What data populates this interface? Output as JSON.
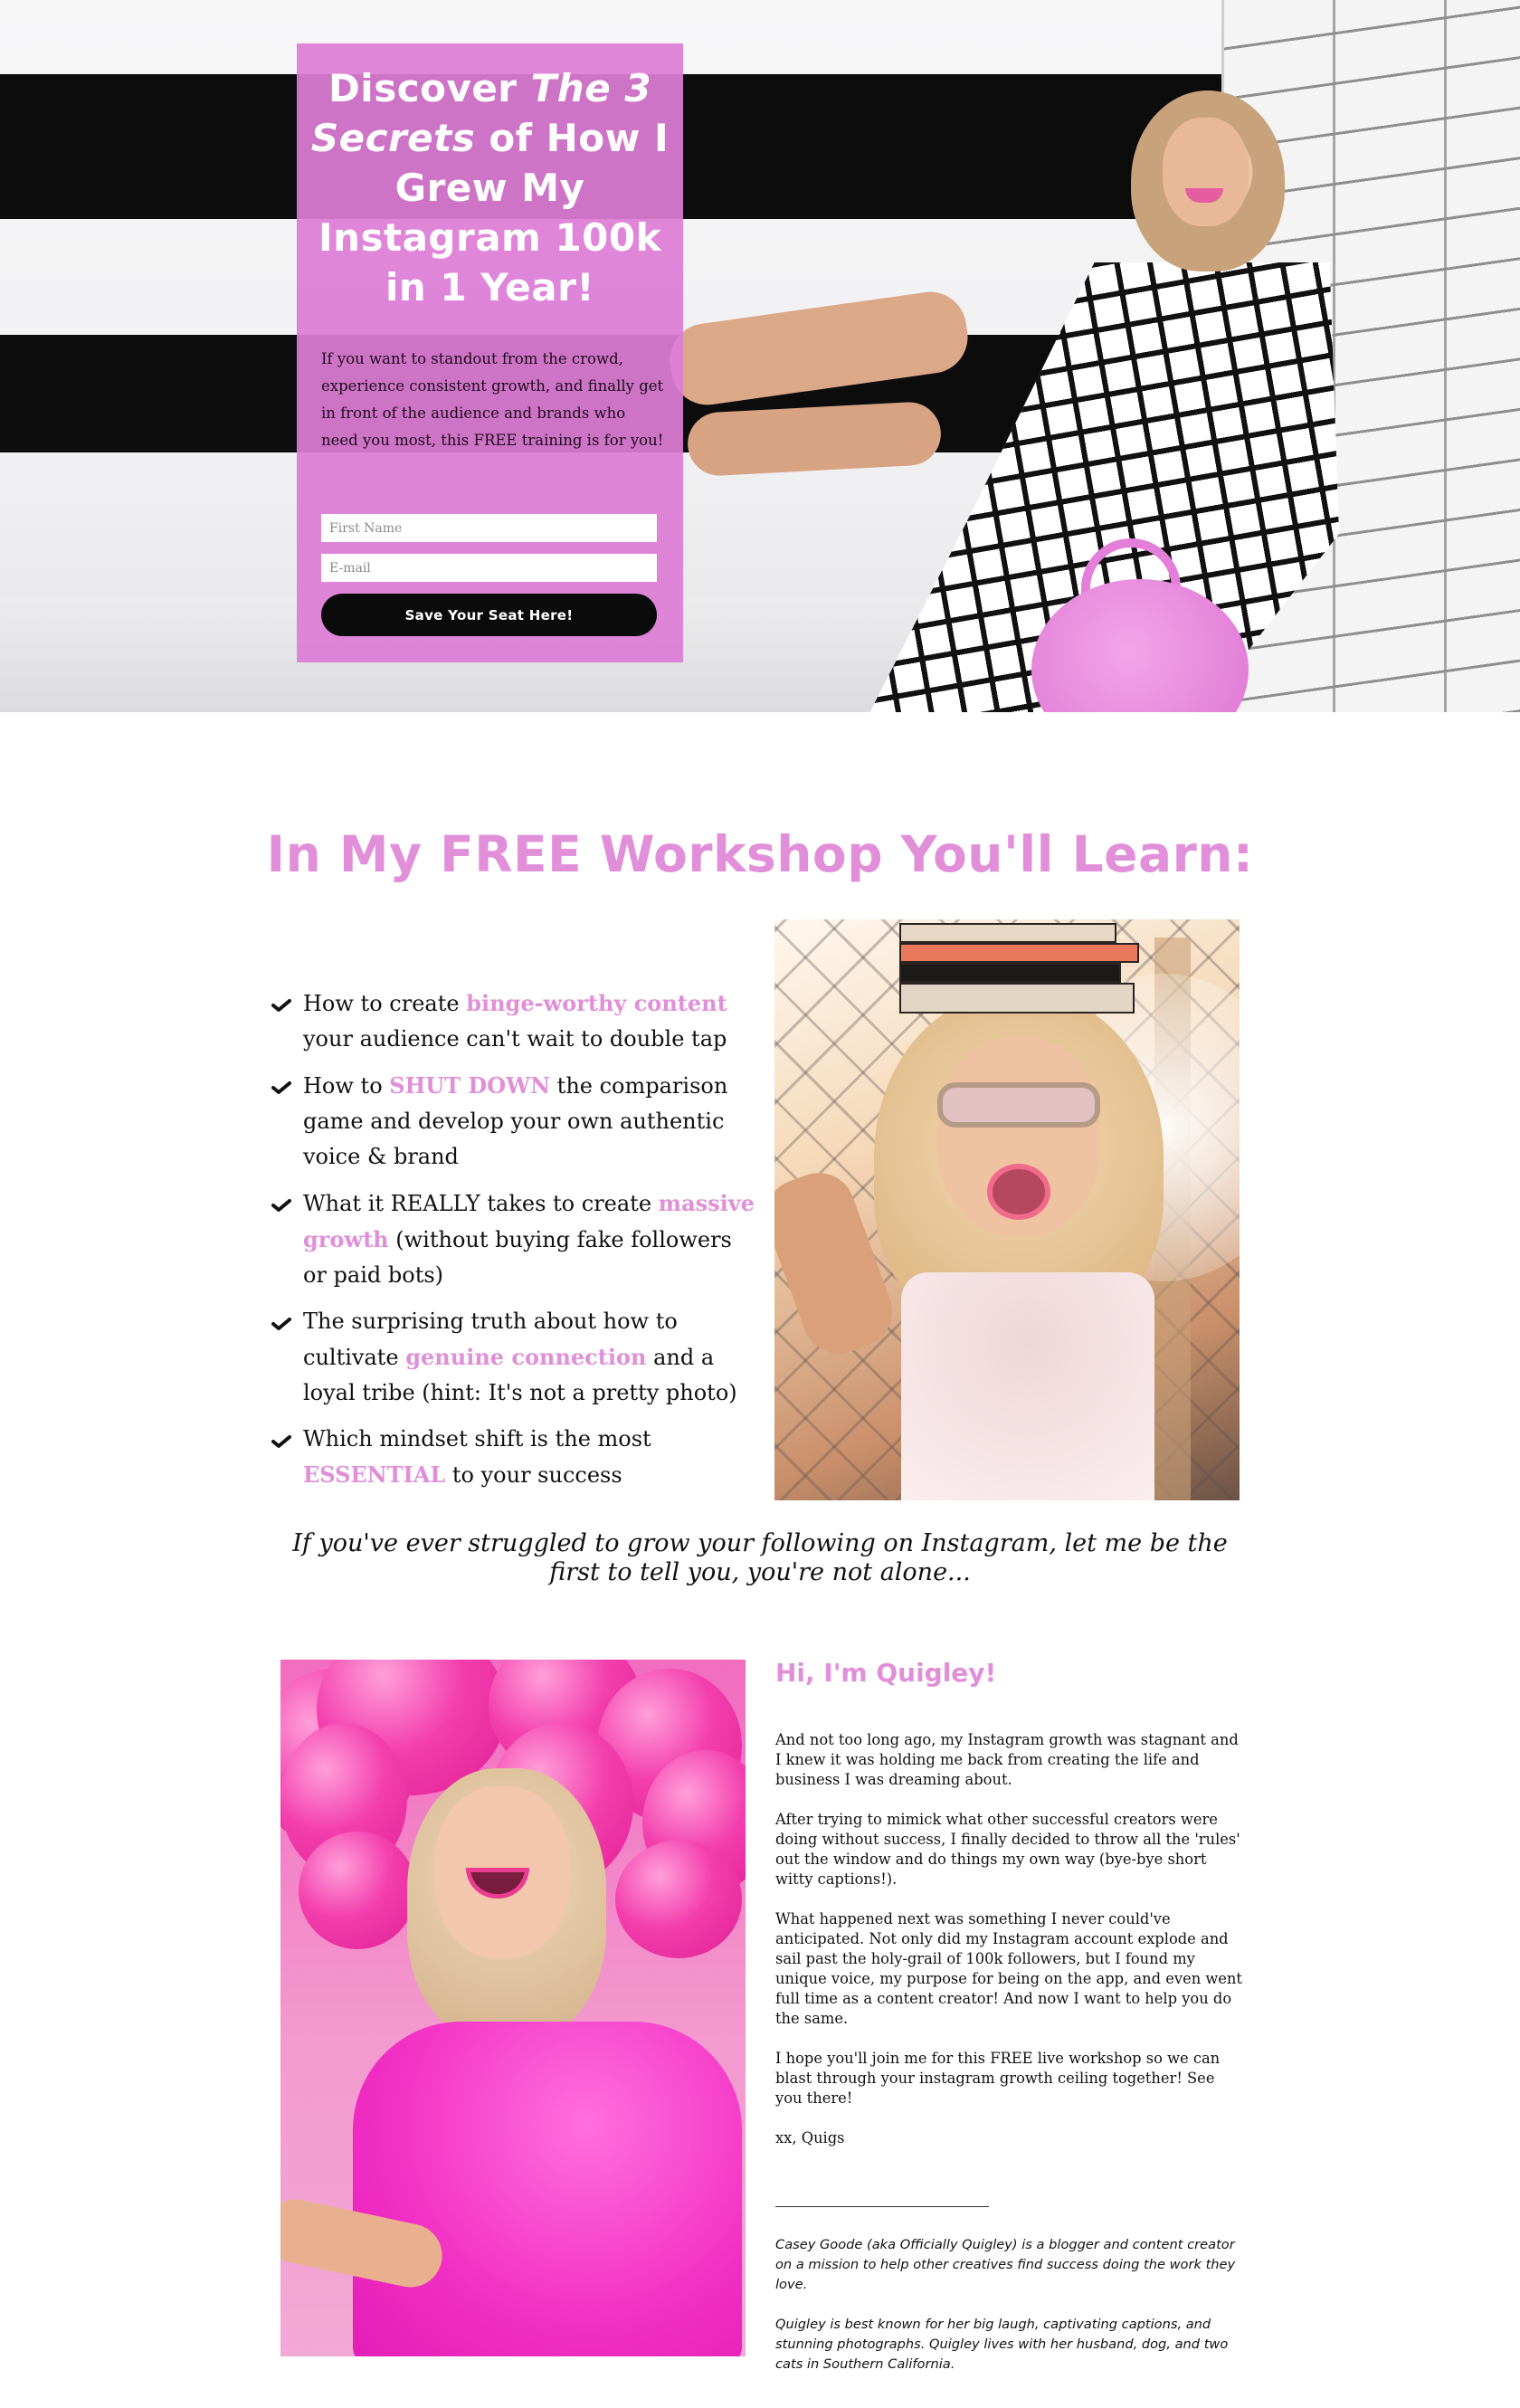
{
  "hero": {
    "title_part1": "Discover ",
    "title_em": "The 3 Secrets",
    "title_part2": " of How I Grew My Instagram 100k in 1 Year!",
    "description": "If you want to standout from the crowd, experience consistent growth, and finally get in front of the audience and brands who need you most, this FREE training is for you!",
    "form": {
      "first_name_placeholder": "First Name",
      "first_name_value": "",
      "email_placeholder": "E-mail",
      "email_value": "",
      "submit_label": "Save Your Seat Here!"
    }
  },
  "learn": {
    "title": "In My FREE Workshop You'll Learn:",
    "items": [
      {
        "before": "How to create ",
        "highlight": "binge-worthy content",
        "after": " your audience can't wait to double tap"
      },
      {
        "before": "How to ",
        "highlight": "SHUT DOWN",
        "after": " the comparison game and develop your own authentic voice & brand"
      },
      {
        "before": "What it REALLY takes to create ",
        "highlight": "massive growth",
        "after": " (without buying fake followers or paid bots)"
      },
      {
        "before": "The surprising truth about how to cultivate ",
        "highlight": "genuine connection",
        "after": " and a loyal tribe (hint: It's not a pretty photo)"
      },
      {
        "before": "Which mindset shift is the most ",
        "highlight": "ESSENTIAL",
        "after": " to your success"
      }
    ],
    "check_icon": "check-icon"
  },
  "quote": "If you've ever struggled to grow your following on Instagram, let me be the first to tell you, you're not alone...",
  "about": {
    "heading": "Hi, I'm Quigley!",
    "paragraphs": [
      "And not too long ago, my Instagram growth was stagnant and I knew it was holding me back from creating the life and business I was dreaming about.",
      "After trying to mimick what other successful creators were doing without success, I finally decided to throw all the 'rules' out the window and do things my own way (bye-bye short witty captions!).",
      "What happened next was something I never could've anticipated. Not only did my Instagram account explode and sail past the holy-grail of 100k followers, but I found my unique voice, my purpose for being on the app, and even went full time as a content creator! And now I want to help you do the same.",
      "I hope you'll join me for this FREE live workshop so we can blast through your instagram growth ceiling together! See you there!",
      "xx, Quigs"
    ],
    "bio": [
      "Casey Goode (aka Officially Quigley) is a blogger and content creator on a mission to help other creatives find success doing the work they love.",
      "Quigley is best known for her big laugh, captivating captions, and stunning photographs. Quigley lives with her husband, dog, and two cats in Southern California."
    ]
  },
  "colors": {
    "accent_pink": "#e08fd8",
    "card_pink": "#dd7dd6",
    "button_black": "#0b0b0b",
    "text": "#111111"
  }
}
